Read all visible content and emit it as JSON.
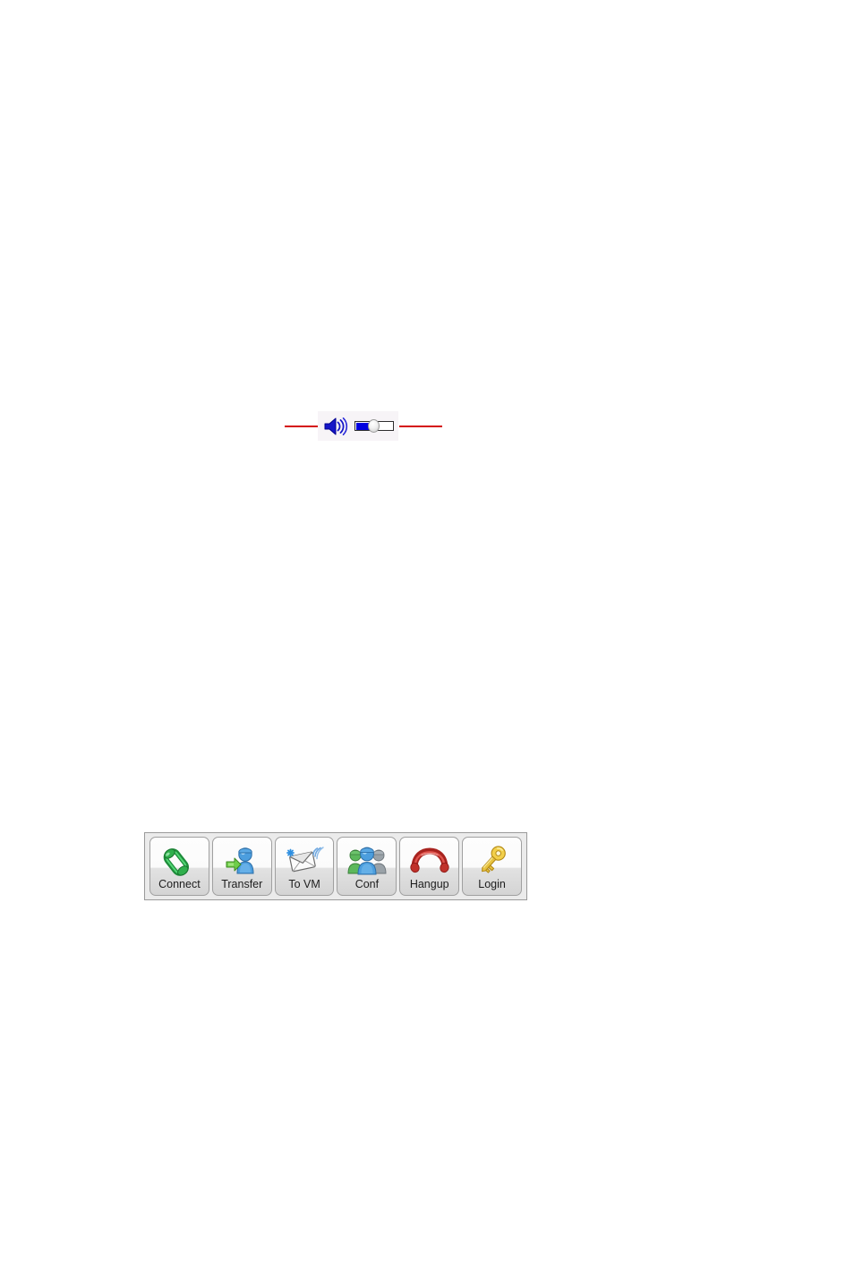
{
  "volume_widget": {
    "name": "volume-control",
    "speaker_icon": "speaker-volume-icon",
    "slider": {
      "name": "volume-slider",
      "value_percent": 34,
      "fill_color": "#0000e0",
      "track_color": "#ffffff",
      "border_color": "#2e2e2e"
    },
    "callouts": {
      "left_line_color": "#d40f0f",
      "right_line_color": "#d40f0f"
    },
    "panel_background": "#f7f4f7"
  },
  "call_toolbar": {
    "name": "call-control-toolbar",
    "background": "#ebebeb",
    "border_color": "#9a9a9a",
    "buttons": [
      {
        "label": "Connect",
        "icon": "green-handset-icon",
        "accent": "#2aa84a"
      },
      {
        "label": "Transfer",
        "icon": "person-transfer-icon",
        "accent": "#4a90d9"
      },
      {
        "label": "To VM",
        "icon": "envelope-voicemail-icon",
        "accent": "#7fb2e5"
      },
      {
        "label": "Conf",
        "icon": "people-group-icon",
        "accent": "#3b86c6"
      },
      {
        "label": "Hangup",
        "icon": "red-handset-icon",
        "accent": "#c0392b"
      },
      {
        "label": "Login",
        "icon": "gold-key-icon",
        "accent": "#e0b32d"
      }
    ]
  }
}
